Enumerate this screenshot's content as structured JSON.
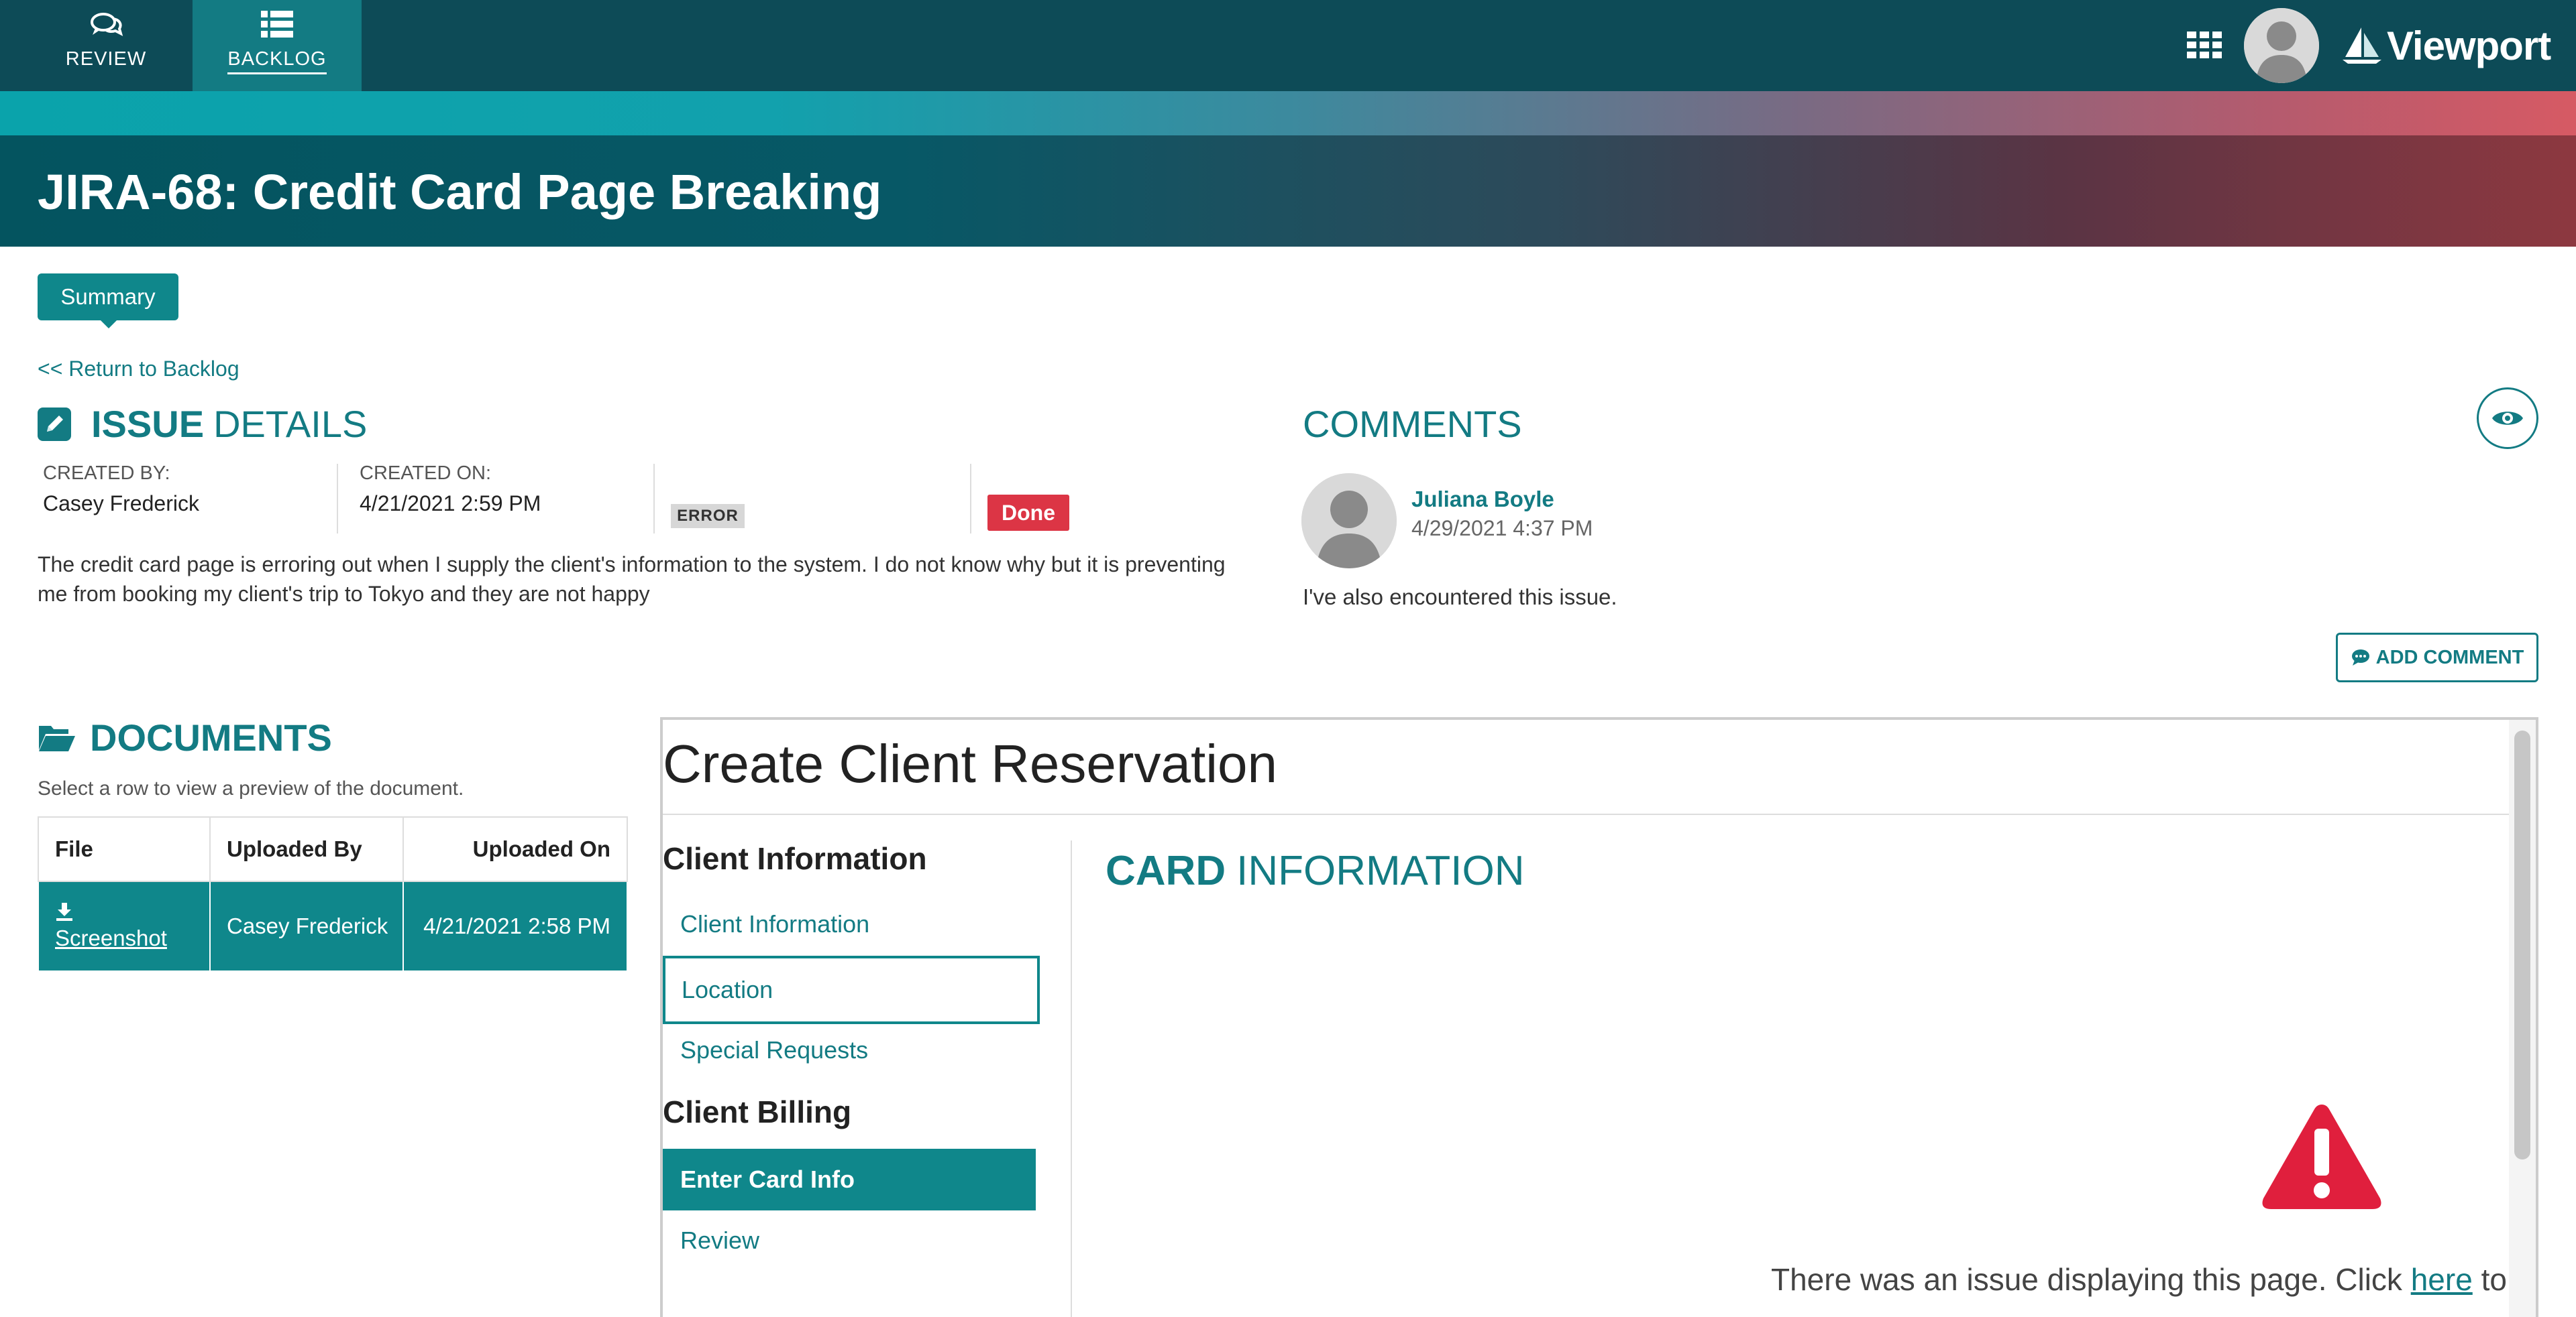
{
  "topnav": {
    "review_label": "REVIEW",
    "backlog_label": "BACKLOG",
    "logo_text": "Viewport",
    "apps_icon": "grid-icon",
    "review_icon": "chat-bubbles-icon",
    "backlog_icon": "list-icon"
  },
  "page": {
    "title": "JIRA-68: Credit Card Page Breaking",
    "tab_summary": "Summary",
    "return_link": "<< Return to Backlog"
  },
  "issue": {
    "heading_bold": "ISSUE",
    "heading_rest": "DETAILS",
    "created_by_label": "CREATED BY:",
    "created_by": "Casey Frederick",
    "created_on_label": "CREATED ON:",
    "created_on": "4/21/2021 2:59 PM",
    "type": "ERROR",
    "status": "Done",
    "description": "The credit card page is erroring out when I supply the client's information to the system. I do not know why but it is preventing me from booking my client's trip to Tokyo and they are not happy"
  },
  "comments": {
    "heading": "COMMENTS",
    "items": [
      {
        "author": "Juliana Boyle",
        "date": "4/29/2021 4:37 PM",
        "text": "I've also encountered this issue."
      }
    ],
    "add_label": "ADD COMMENT"
  },
  "documents": {
    "heading": "DOCUMENTS",
    "hint": "Select a row to view a preview of the document.",
    "columns": [
      "File",
      "Uploaded By",
      "Uploaded On"
    ],
    "rows": [
      {
        "file": "Screenshot",
        "by": "Casey Frederick",
        "on": "4/21/2021 2:58 PM"
      }
    ]
  },
  "preview": {
    "title": "Create Client Reservation",
    "section1": "Client Information",
    "link1": "Client Information",
    "link2": "Location",
    "link3": "Special Requests",
    "section2": "Client Billing",
    "active": "Enter Card Info",
    "link4": "Review",
    "card_bold": "CARD",
    "card_rest": "INFORMATION",
    "error_text": "There was an issue displaying this page.  Click",
    "error_link": "here",
    "error_tail": "to l"
  },
  "colors": {
    "teal": "#137b83",
    "danger": "#dc3545",
    "topbar": "#0d4b57"
  }
}
